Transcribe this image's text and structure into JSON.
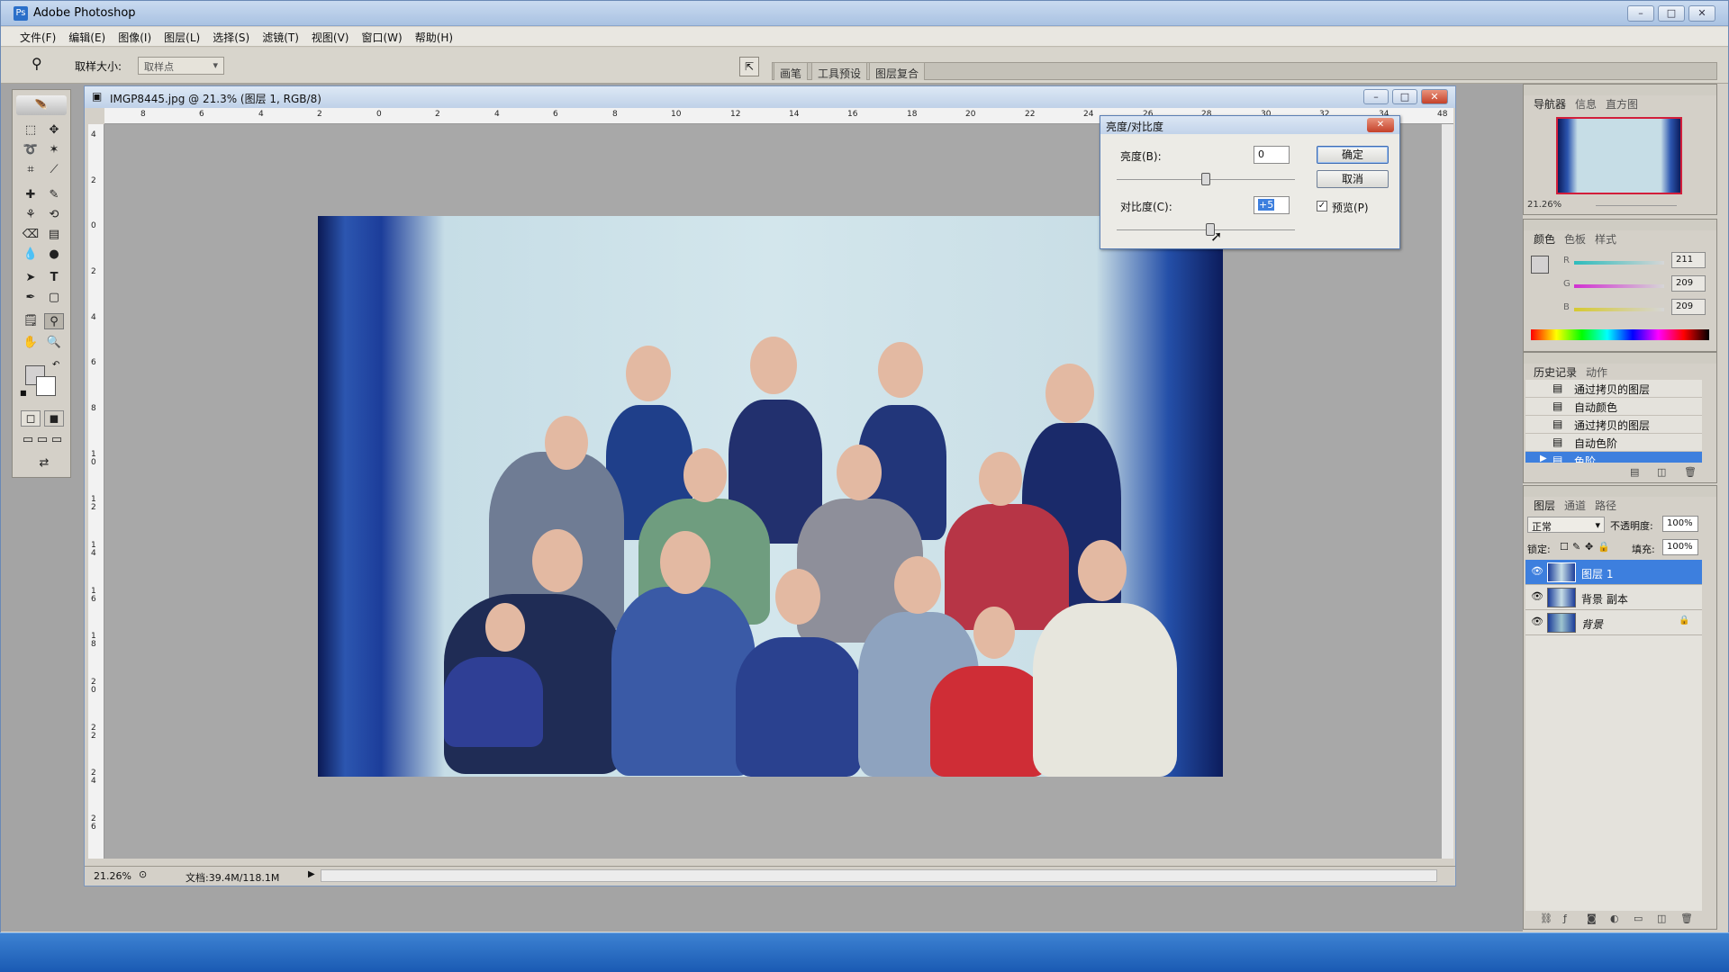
{
  "app": {
    "title": "Adobe Photoshop"
  },
  "window_controls": {
    "minimize": "–",
    "maximize": "□",
    "close": "✕"
  },
  "menu": [
    "文件(F)",
    "编辑(E)",
    "图像(I)",
    "图层(L)",
    "选择(S)",
    "滤镜(T)",
    "视图(V)",
    "窗口(W)",
    "帮助(H)"
  ],
  "options_bar": {
    "sample_size_label": "取样大小:",
    "sample_size_value": "取样点",
    "well_tabs": [
      "画笔",
      "工具预设",
      "图层复合"
    ]
  },
  "document": {
    "title": "IMGP8445.jpg @ 21.3% (图层 1, RGB/8)",
    "ruler_h": [
      "8",
      "6",
      "4",
      "2",
      "0",
      "2",
      "4",
      "6",
      "8",
      "10",
      "12",
      "14",
      "16",
      "18",
      "20",
      "22",
      "24",
      "26",
      "28",
      "30",
      "32",
      "34",
      "48"
    ],
    "ruler_v": [
      "4",
      "2",
      "0",
      "2",
      "4",
      "6",
      "8",
      "1 0",
      "1 2",
      "1 4",
      "1 6",
      "1 8",
      "2 0",
      "2 2",
      "2 4",
      "2 6"
    ],
    "zoom": "21.26%",
    "doc_size": "文档:39.4M/118.1M"
  },
  "dialog": {
    "title": "亮度/对比度",
    "brightness_label": "亮度(B):",
    "brightness_value": "0",
    "brightness_level": 0,
    "contrast_label": "对比度(C):",
    "contrast_value": "+5",
    "contrast_level": 5,
    "ok_label": "确定",
    "cancel_label": "取消",
    "preview_label": "预览(P)",
    "preview_checked": true
  },
  "navigator_panel": {
    "tabs": [
      "导航器",
      "信息",
      "直方图"
    ],
    "zoom": "21.26%"
  },
  "color_panel": {
    "tabs": [
      "颜色",
      "色板",
      "样式"
    ],
    "channels": [
      {
        "name": "R",
        "value": "211"
      },
      {
        "name": "G",
        "value": "209"
      },
      {
        "name": "B",
        "value": "209"
      }
    ]
  },
  "history_panel": {
    "tabs": [
      "历史记录",
      "动作"
    ],
    "items": [
      "通过拷贝的图层",
      "自动颜色",
      "通过拷贝的图层",
      "自动色阶",
      "色阶"
    ],
    "selected_index": 4
  },
  "layers_panel": {
    "tabs": [
      "图层",
      "通道",
      "路径"
    ],
    "blend_mode": "正常",
    "opacity_label": "不透明度:",
    "opacity_value": "100%",
    "lock_label": "锁定:",
    "fill_label": "填充:",
    "fill_value": "100%",
    "layers": [
      {
        "name": "图层 1",
        "selected": true
      },
      {
        "name": "背景 副本",
        "selected": false
      },
      {
        "name": "背景",
        "selected": false
      }
    ]
  },
  "colors": {
    "selection_blue": "#3d7fde",
    "title_gradient_top": "#c9daf0",
    "panel_bg": "#d4d0c8"
  }
}
